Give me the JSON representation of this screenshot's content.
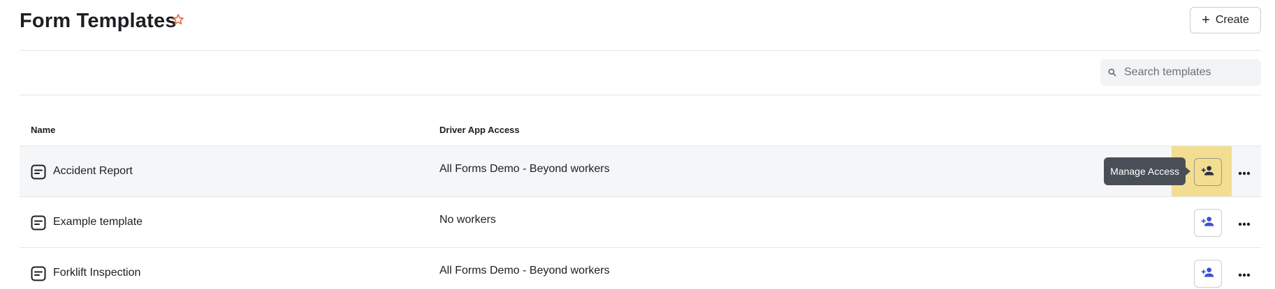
{
  "header": {
    "title": "Form Templates",
    "favorite_icon": "star-outline-icon",
    "create_label": "Create",
    "create_icon": "plus-icon",
    "accent_color": "#e8612c"
  },
  "search": {
    "placeholder": "Search templates",
    "icon": "search-icon"
  },
  "table": {
    "columns": [
      "Name",
      "Driver App Access"
    ],
    "rows": [
      {
        "name": "Accident Report",
        "access": "All Forms Demo - Beyond workers",
        "icon": "form-template-icon",
        "hovered": true,
        "tooltip": "Manage Access"
      },
      {
        "name": "Example template",
        "access": "No workers",
        "icon": "form-template-icon",
        "hovered": false
      },
      {
        "name": "Forklift Inspection",
        "access": "All Forms Demo - Beyond workers",
        "icon": "form-template-icon",
        "hovered": false
      }
    ],
    "row_actions": {
      "manage_access_icon": "person-add-icon",
      "more_icon": "more-horizontal-icon",
      "icon_color": "#3b4fd8"
    }
  }
}
